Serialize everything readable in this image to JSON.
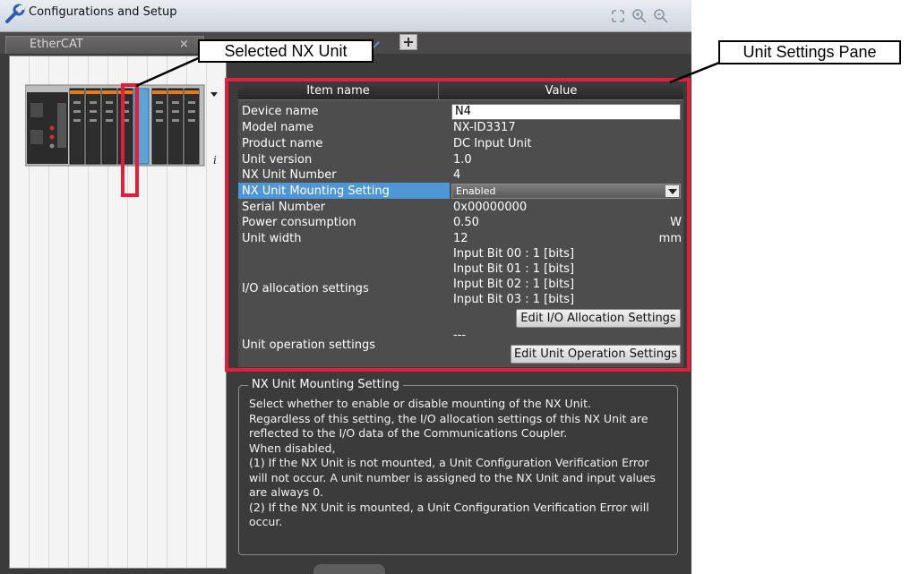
{
  "window": {
    "title": "Configurations and Setup",
    "title_icon": "wrench-icon",
    "tools": [
      "fit-icon",
      "zoom-in-icon",
      "zoom-out-icon"
    ]
  },
  "tabs": {
    "active_label": "EtherCAT",
    "close_glyph": "×",
    "add_glyph": "+"
  },
  "grid": {
    "header": {
      "item": "Item name",
      "value": "Value"
    },
    "rows": [
      {
        "name": "Device name",
        "value": "N4",
        "unit": ""
      },
      {
        "name": "Model name",
        "value": "NX-ID3317",
        "unit": ""
      },
      {
        "name": "Product name",
        "value": "DC Input Unit",
        "unit": ""
      },
      {
        "name": "Unit version",
        "value": "1.0",
        "unit": ""
      },
      {
        "name": "NX Unit Number",
        "value": "4",
        "unit": ""
      },
      {
        "name": "NX Unit Mounting Setting",
        "value": "Enabled",
        "unit": ""
      },
      {
        "name": "Serial Number",
        "value": "0x00000000",
        "unit": ""
      },
      {
        "name": "Power consumption",
        "value": "0.50",
        "unit": "W"
      },
      {
        "name": "Unit width",
        "value": "12",
        "unit": "mm"
      }
    ],
    "io": {
      "label": "I/O allocation settings",
      "values": [
        "Input Bit 00 : 1 [bits]",
        "Input Bit 01 : 1 [bits]",
        "Input Bit 02 : 1 [bits]",
        "Input Bit 03 : 1 [bits]"
      ],
      "button": "Edit I/O Allocation Settings"
    },
    "op": {
      "label": "Unit operation settings",
      "value": "---",
      "button": "Edit Unit Operation Settings"
    }
  },
  "description": {
    "title": "NX Unit Mounting Setting",
    "lines": [
      "Select whether to enable or disable mounting of the NX Unit.",
      "Regardless of this setting, the I/O allocation settings of this NX Unit are",
      "reflected to the I/O data of the Communications Coupler.",
      "When disabled,",
      "(1) If the NX Unit is not mounted, a Unit Configuration Verification Error",
      "will not occur. A unit number is assigned to the NX Unit and input values",
      "are always 0.",
      "(2) If the NX Unit is mounted, a Unit Configuration Verification Error will",
      "occur."
    ]
  },
  "callouts": {
    "selected_unit": "Selected NX Unit",
    "settings_pane": "Unit Settings Pane"
  },
  "colors": {
    "highlight_red": "#e0203a",
    "selection_blue": "#4f97d4",
    "panel_dark": "#3b3b3b"
  }
}
